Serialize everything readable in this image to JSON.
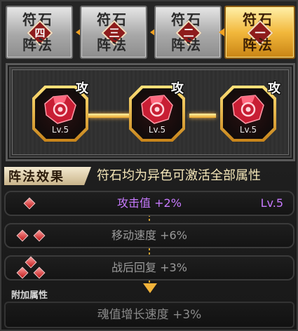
{
  "tabs": [
    {
      "top": "符石",
      "number": "四",
      "bottom": "阵法",
      "active": false
    },
    {
      "top": "符石",
      "number": "三",
      "bottom": "阵法",
      "active": false
    },
    {
      "top": "符石",
      "number": "二",
      "bottom": "阵法",
      "active": false
    },
    {
      "top": "符石",
      "number": "一",
      "bottom": "阵法",
      "active": true
    }
  ],
  "rune_slots": [
    {
      "level": "Lv.5",
      "tag": "攻",
      "gem": "red-rune-gem-icon"
    },
    {
      "level": "Lv.5",
      "tag": "攻",
      "gem": "red-rune-gem-icon"
    },
    {
      "level": "Lv.5",
      "tag": "攻",
      "gem": "red-rune-gem-icon"
    }
  ],
  "effect": {
    "tag": "阵法效果",
    "description": "符石均为异色可激活全部属性"
  },
  "attributes": [
    {
      "label": "攻击值 +2%",
      "level": "Lv.5",
      "active": true,
      "diamonds": 1
    },
    {
      "label": "移动速度 +6%",
      "level": "",
      "active": false,
      "diamonds": 2
    },
    {
      "label": "战后回复 +3%",
      "level": "",
      "active": false,
      "diamonds": 3
    }
  ],
  "extra": {
    "label": "附加属性",
    "value": "魂值增长速度 +3%"
  },
  "colors": {
    "active_tab": "#f2b83c",
    "active_attribute": "#c87aff",
    "inactive_text": "#9a9a9a",
    "connector": "#ffd060",
    "gem": "#e8283c"
  }
}
